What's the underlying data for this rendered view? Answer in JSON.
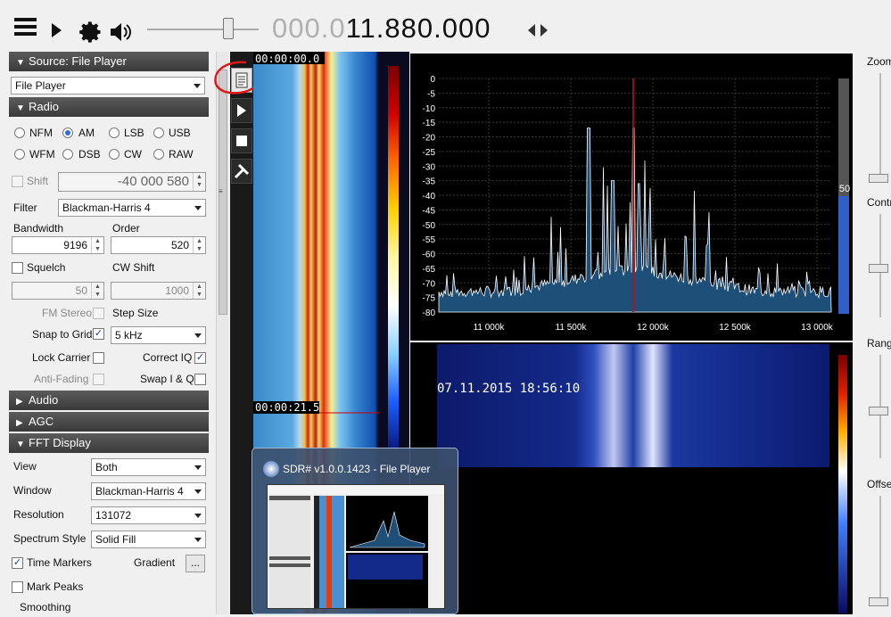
{
  "toolbar": {
    "frequency_dim": "000.0",
    "frequency_bright": "11.880.000"
  },
  "source": {
    "header": "Source: File Player",
    "selected": "File Player"
  },
  "radio": {
    "header": "Radio",
    "modes": [
      "NFM",
      "AM",
      "LSB",
      "USB",
      "WFM",
      "DSB",
      "CW",
      "RAW"
    ],
    "selected_mode": "AM",
    "shift_label": "Shift",
    "shift_value": "-40 000 580",
    "filter_label": "Filter",
    "filter_value": "Blackman-Harris 4",
    "bandwidth_label": "Bandwidth",
    "bandwidth_value": "9196",
    "order_label": "Order",
    "order_value": "520",
    "squelch_label": "Squelch",
    "squelch_value": "50",
    "cw_shift_label": "CW Shift",
    "cw_shift_value": "1000",
    "fm_stereo_label": "FM Stereo",
    "step_size_label": "Step Size",
    "snap_label": "Snap to Grid",
    "snap_checked": "✓",
    "step_value": "5 kHz",
    "lock_carrier_label": "Lock Carrier",
    "correct_iq_label": "Correct IQ",
    "correct_iq_checked": "✓",
    "anti_fading_label": "Anti-Fading",
    "swap_iq_label": "Swap I & Q"
  },
  "audio": {
    "header": "Audio"
  },
  "agc": {
    "header": "AGC"
  },
  "fft": {
    "header": "FFT Display",
    "view_label": "View",
    "view_value": "Both",
    "window_label": "Window",
    "window_value": "Blackman-Harris 4",
    "resolution_label": "Resolution",
    "resolution_value": "131072",
    "style_label": "Spectrum Style",
    "style_value": "Solid Fill",
    "time_markers_label": "Time Markers",
    "time_markers_checked": "✓",
    "gradient_label": "Gradient",
    "gradient_button": "...",
    "mark_peaks_label": "Mark Peaks",
    "smoothing_label": "Smoothing"
  },
  "waterfall": {
    "time_top": "00:00:00.0",
    "time_mid": "00:00:21.5"
  },
  "spectrum": {
    "y_ticks": [
      "0",
      "-5",
      "-10",
      "-15",
      "-20",
      "-25",
      "-30",
      "-35",
      "-40",
      "-45",
      "-50",
      "-55",
      "-60",
      "-65",
      "-70",
      "-75",
      "-80"
    ],
    "x_ticks": [
      "11 000k",
      "11 500k",
      "12 000k",
      "12 500k",
      "13 000k"
    ],
    "level_value": "50",
    "level_fraction": 0.5
  },
  "waterfall2": {
    "timestamp": "07.11.2015 18:56:10"
  },
  "right_panel": {
    "zoom_label": "Zoom",
    "contrast_label": "Contra",
    "range_label": "Range",
    "offset_label": "Offse"
  },
  "preview": {
    "title": "SDR# v1.0.0.1423 - File Player"
  },
  "colors": {
    "accent": "#2c6fd6",
    "spectrum_fill": "#1e4f78",
    "marker": "#c01010"
  }
}
